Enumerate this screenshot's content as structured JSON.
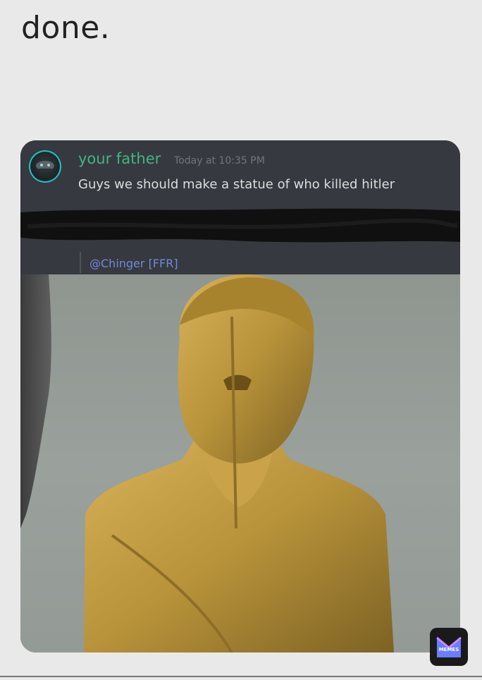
{
  "caption": "done.",
  "chat": {
    "username": "your father",
    "timestamp": "Today at 10:35 PM",
    "message": "Guys we should make a statue of who killed hitler",
    "mention": "@Chinger [FFR]"
  },
  "image": {
    "icon": "gold-statue-bust-image"
  },
  "watermark": {
    "icon": "memes-app-logo",
    "label": "MEMES"
  },
  "colors": {
    "page_background": "#e9e9e9",
    "chat_background": "#36393f",
    "username": "#43b581",
    "timestamp": "#72767d",
    "message_text": "#dcddde",
    "mention": "#7289da",
    "statue_gold": "#b8933a"
  }
}
